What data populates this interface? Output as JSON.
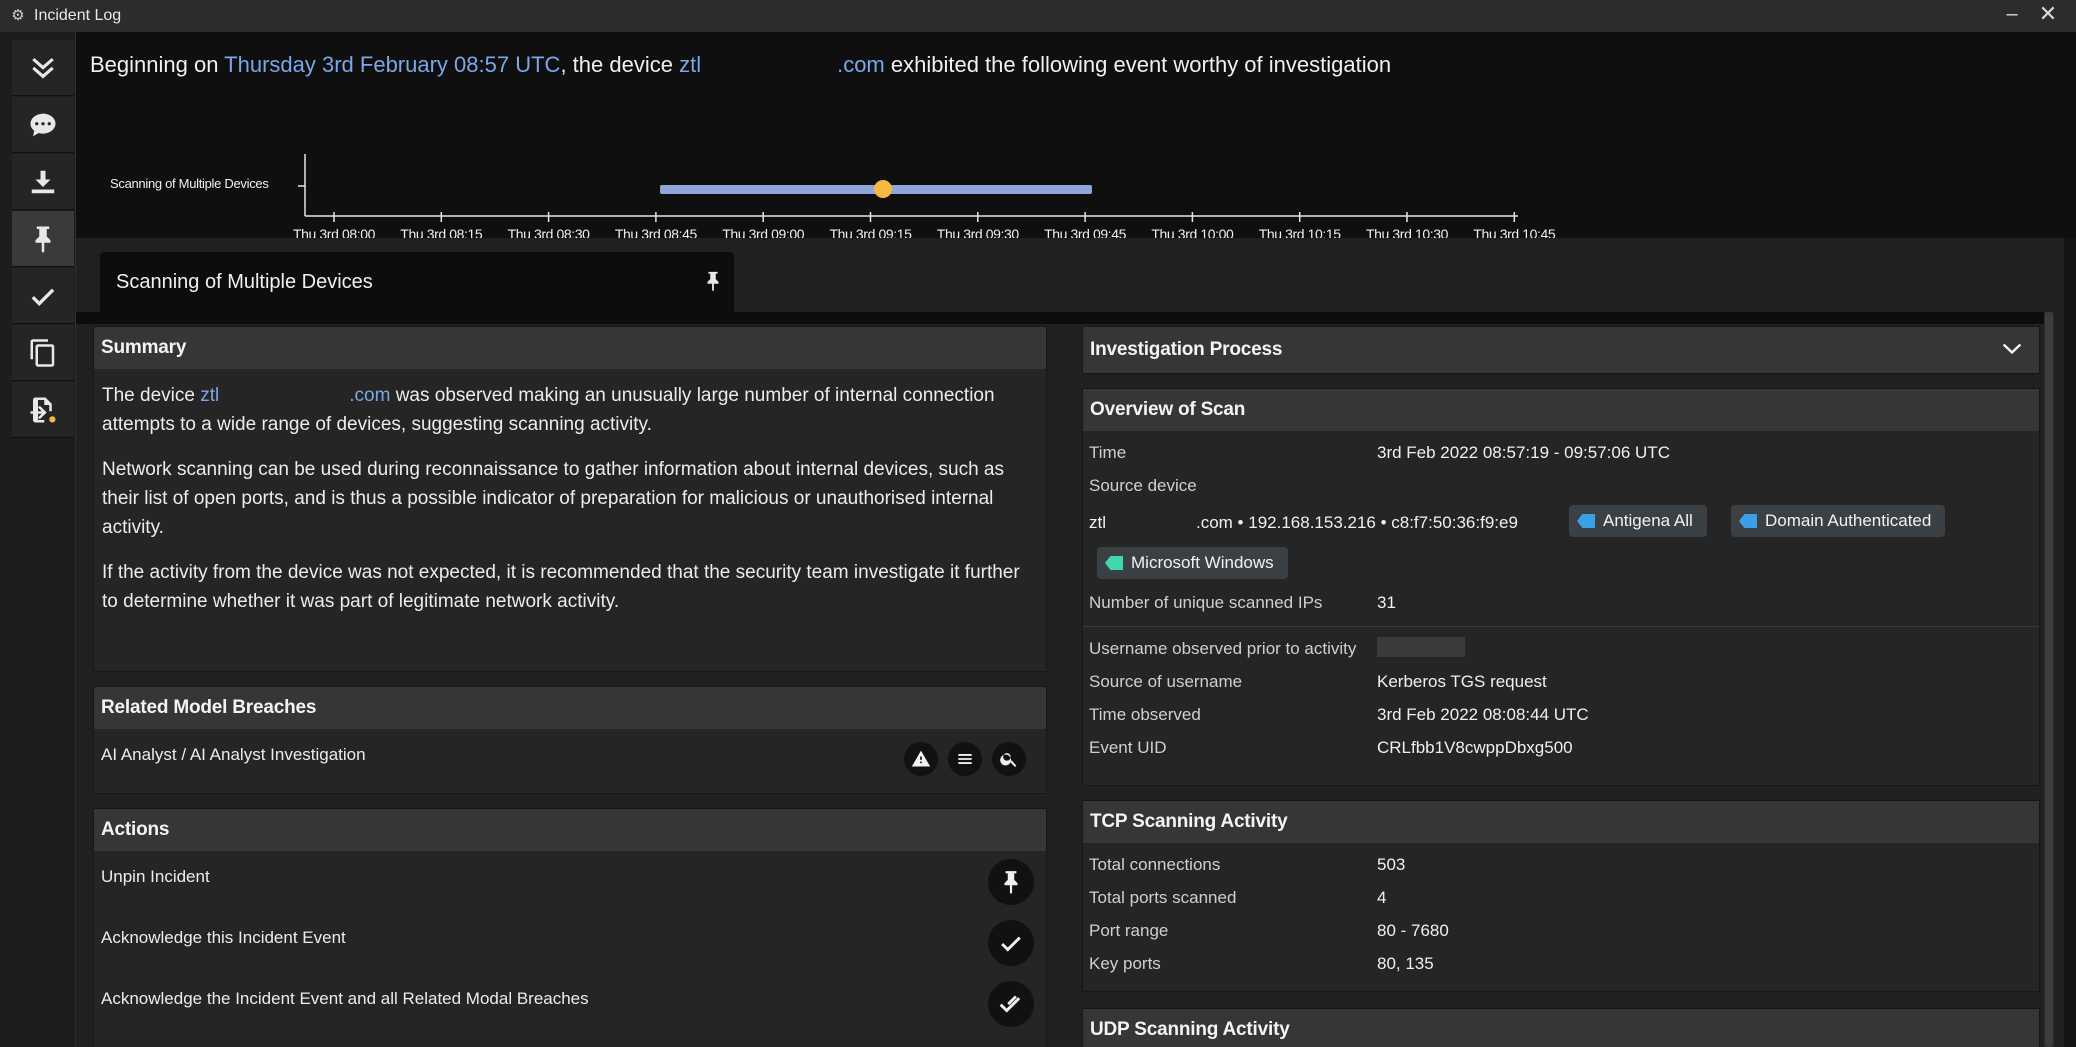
{
  "window": {
    "title": "Incident Log",
    "minimize": "–",
    "close": "✕"
  },
  "toolbar": [
    "collapse-icon",
    "comment-icon",
    "download-icon",
    "pin-icon",
    "check-icon",
    "copy-icon",
    "export-icon"
  ],
  "header": {
    "prefix": "Beginning on ",
    "date": "Thursday 3rd February 08:57 UTC",
    "middle": ", the device ",
    "device_start": "ztl",
    "device_end": ".com",
    "suffix": " exhibited the following event worthy of investigation"
  },
  "timeline": {
    "row_label": "Scanning of Multiple Devices",
    "ticks": [
      "Thu 3rd 08:00",
      "Thu 3rd 08:15",
      "Thu 3rd 08:30",
      "Thu 3rd 08:45",
      "Thu 3rd 09:00",
      "Thu 3rd 09:15",
      "Thu 3rd 09:30",
      "Thu 3rd 09:45",
      "Thu 3rd 10:00",
      "Thu 3rd 10:15",
      "Thu 3rd 10:30",
      "Thu 3rd 10:45"
    ],
    "bar_color": "#8fa6d8",
    "marker_color": "#f5b942"
  },
  "tab": {
    "label": "Scanning of Multiple Devices"
  },
  "summary": {
    "title": "Summary",
    "p1_a": "The device ",
    "p1_device_start": "ztl",
    "p1_device_end": ".com",
    "p1_b": " was observed making an unusually large number of internal connection attempts to a wide range of devices, suggesting scanning activity.",
    "p2": "Network scanning can be used during reconnaissance to gather information about internal devices, such as their list of open ports, and is thus a possible indicator of preparation for malicious or unauthorised internal activity.",
    "p3": "If the activity from the device was not expected, it is recommended that the security team investigate it further to determine whether it was part of legitimate network activity."
  },
  "related": {
    "title": "Related Model Breaches",
    "item": "AI Analyst / AI Analyst Investigation"
  },
  "actions": {
    "title": "Actions",
    "items": [
      "Unpin Incident",
      "Acknowledge this Incident Event",
      "Acknowledge the Incident Event and all Related Modal Breaches"
    ]
  },
  "investigation": {
    "title": "Investigation Process"
  },
  "overview": {
    "title": "Overview of Scan",
    "time_label": "Time",
    "time_value": "3rd Feb 2022 08:57:19 - 09:57:06 UTC",
    "source_label": "Source device",
    "device_start": "ztl",
    "device_rest": ".com • 192.168.153.216 • c8:f7:50:36:f9:e9",
    "tags": [
      {
        "label": "Antigena All",
        "color": "#3aa0e6"
      },
      {
        "label": "Domain Authenticated",
        "color": "#3aa0e6"
      },
      {
        "label": "Microsoft Windows",
        "color": "#3fd6b0"
      }
    ],
    "unique_label": "Number of unique scanned IPs",
    "unique_value": "31",
    "username_label": "Username observed prior to activity",
    "src_user_label": "Source of username",
    "src_user_value": "Kerberos TGS request",
    "observed_label": "Time observed",
    "observed_value": "3rd Feb 2022 08:08:44 UTC",
    "uid_label": "Event UID",
    "uid_value": "CRLfbb1V8cwppDbxg500"
  },
  "tcp": {
    "title": "TCP Scanning Activity",
    "rows": [
      {
        "k": "Total connections",
        "v": "503"
      },
      {
        "k": "Total ports scanned",
        "v": "4"
      },
      {
        "k": "Port range",
        "v": "80 - 7680"
      },
      {
        "k": "Key ports",
        "v": "80, 135"
      }
    ]
  },
  "udp": {
    "title": "UDP Scanning Activity"
  }
}
